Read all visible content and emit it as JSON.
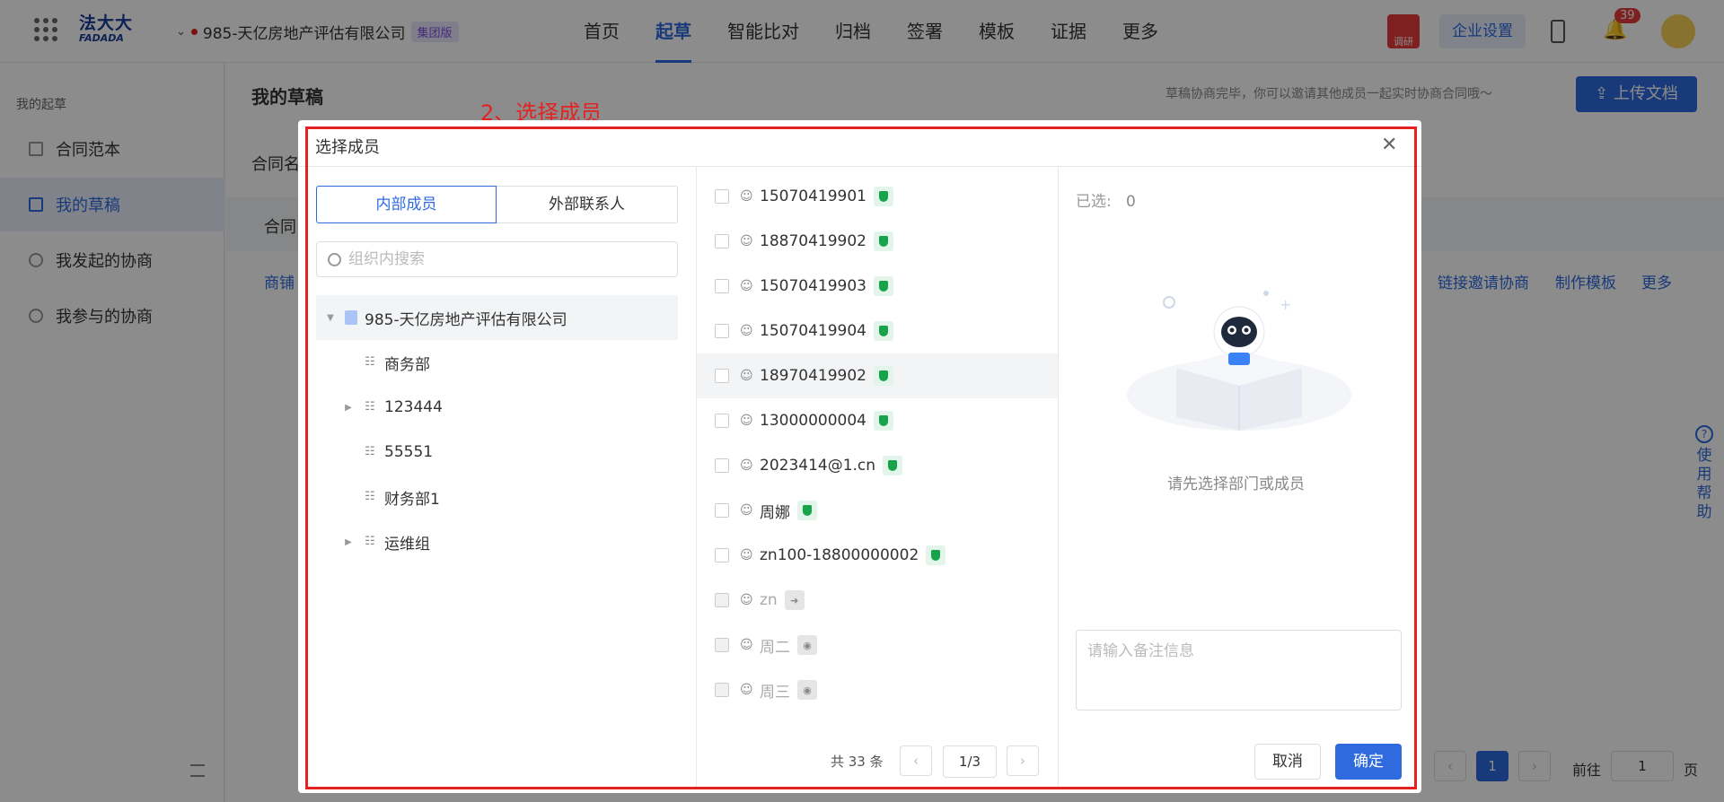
{
  "header": {
    "logo_cn": "法大大",
    "logo_en": "FADADA",
    "company": "985-天亿房地产评估有限公司",
    "group_badge": "集团版",
    "nav": [
      "首页",
      "起草",
      "智能比对",
      "归档",
      "签署",
      "模板",
      "证据",
      "更多"
    ],
    "active_nav": "起草",
    "survey_label": "调研",
    "enterprise_settings": "企业设置",
    "notification_count": "39",
    "accent": "#2f6bde"
  },
  "sidebar": {
    "caption": "我的起草",
    "items": [
      {
        "label": "合同范本",
        "icon": "document-icon"
      },
      {
        "label": "我的草稿",
        "icon": "draft-icon",
        "active": true
      },
      {
        "label": "我发起的协商",
        "icon": "group-icon"
      },
      {
        "label": "我参与的协商",
        "icon": "user-icon"
      }
    ]
  },
  "main": {
    "title": "我的草稿",
    "tip": "草稿协商完毕，你可以邀请其他成员一起实时协商合同哦～",
    "upload": "上传文档",
    "bg_label1": "合同名",
    "bg_label2": "合同",
    "bg_link_left": "商铺",
    "bg_actions": [
      "链接邀请协商",
      "制作模板",
      "更多"
    ],
    "pagination": {
      "page": "1",
      "goto_label": "前往",
      "goto_value": "1",
      "page_unit": "页"
    }
  },
  "annotation": "2、选择成员",
  "modal": {
    "title": "选择成员",
    "tab_internal": "内部成员",
    "tab_external": "外部联系人",
    "search_placeholder": "组织内搜索",
    "tree": [
      {
        "label": "985-天亿房地产评估有限公司",
        "level": 0,
        "expanded": true,
        "type": "company"
      },
      {
        "label": "商务部",
        "level": 1,
        "expandable": false
      },
      {
        "label": "123444",
        "level": 1,
        "expandable": true
      },
      {
        "label": "55551",
        "level": 1,
        "expandable": false
      },
      {
        "label": "财务部1",
        "level": 1,
        "expandable": false
      },
      {
        "label": "运维组",
        "level": 1,
        "expandable": true
      }
    ],
    "members": [
      {
        "name": "15070419901",
        "status": "verified"
      },
      {
        "name": "18870419902",
        "status": "verified"
      },
      {
        "name": "15070419903",
        "status": "verified"
      },
      {
        "name": "15070419904",
        "status": "verified"
      },
      {
        "name": "18970419902",
        "status": "verified",
        "hover": true
      },
      {
        "name": "13000000004",
        "status": "verified"
      },
      {
        "name": "2023414@1.cn",
        "status": "verified"
      },
      {
        "name": "周娜",
        "status": "verified"
      },
      {
        "name": "zn100-18800000002",
        "status": "verified"
      },
      {
        "name": "zn",
        "status": "disabled-arrow"
      },
      {
        "name": "周二",
        "status": "disabled-shield"
      },
      {
        "name": "周三",
        "status": "disabled-shield"
      }
    ],
    "total": "共 33 条",
    "page": "1/3",
    "selected_label": "已选:",
    "selected_count": "0",
    "empty_text": "请先选择部门或成员",
    "note_placeholder": "请输入备注信息",
    "cancel": "取消",
    "confirm": "确定"
  },
  "help_text": "使用帮助"
}
